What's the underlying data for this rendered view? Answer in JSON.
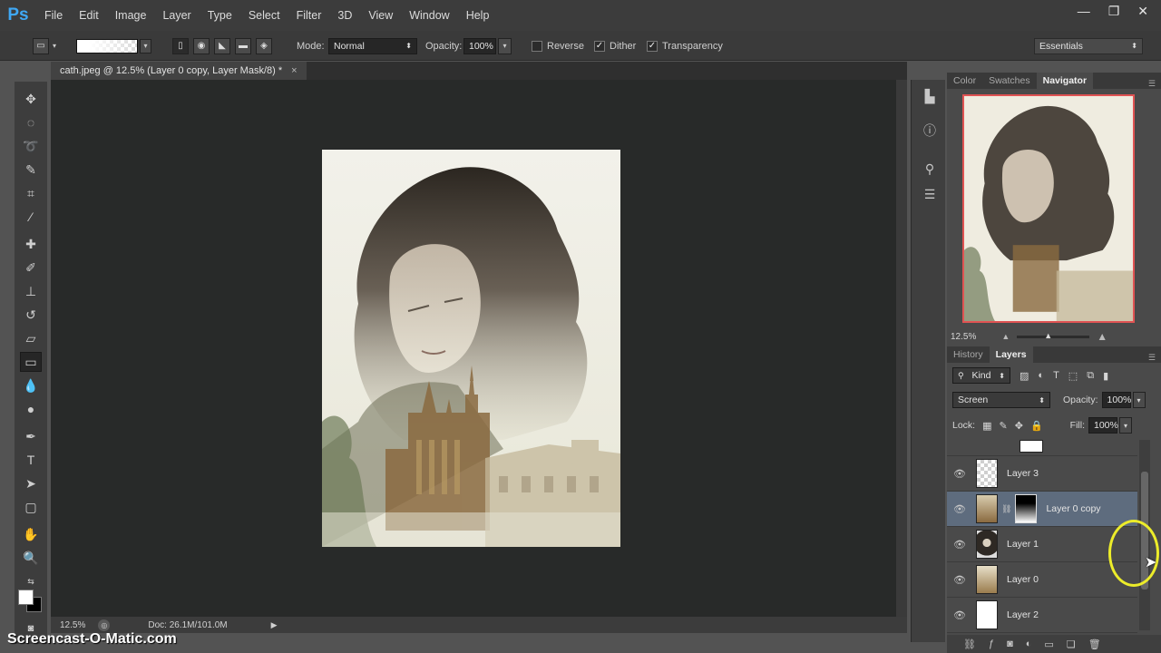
{
  "app": {
    "logo": "Ps",
    "menus": [
      "File",
      "Edit",
      "Image",
      "Layer",
      "Type",
      "Select",
      "Filter",
      "3D",
      "View",
      "Window",
      "Help"
    ],
    "window_controls": [
      "—",
      "❐",
      "✕"
    ]
  },
  "options": {
    "mode_label": "Mode:",
    "mode_value": "Normal",
    "opacity_label": "Opacity:",
    "opacity_value": "100%",
    "reverse_label": "Reverse",
    "dither_label": "Dither",
    "transparency_label": "Transparency",
    "workspace": "Essentials"
  },
  "document": {
    "tab_title": "cath.jpeg @ 12.5% (Layer 0 copy, Layer Mask/8) *",
    "close": "×",
    "zoom": "12.5%",
    "doc_info": "Doc: 26.1M/101.0M"
  },
  "watermark": "Screencast-O-Matic.com",
  "panels": {
    "top_tabs": [
      "Color",
      "Swatches",
      "Navigator"
    ],
    "top_active": "Navigator",
    "navigator_zoom": "12.5%",
    "layer_tabs": [
      "History",
      "Layers"
    ],
    "layer_active": "Layers",
    "filter_kind": "Kind",
    "blend_mode": "Screen",
    "opacity_label": "Opacity:",
    "opacity_value": "100%",
    "lock_label": "Lock:",
    "fill_label": "Fill:",
    "fill_value": "100%",
    "layers": [
      {
        "name": "Layer 3"
      },
      {
        "name": "Layer 0 copy"
      },
      {
        "name": "Layer 1"
      },
      {
        "name": "Layer 0"
      },
      {
        "name": "Layer 2"
      }
    ]
  }
}
